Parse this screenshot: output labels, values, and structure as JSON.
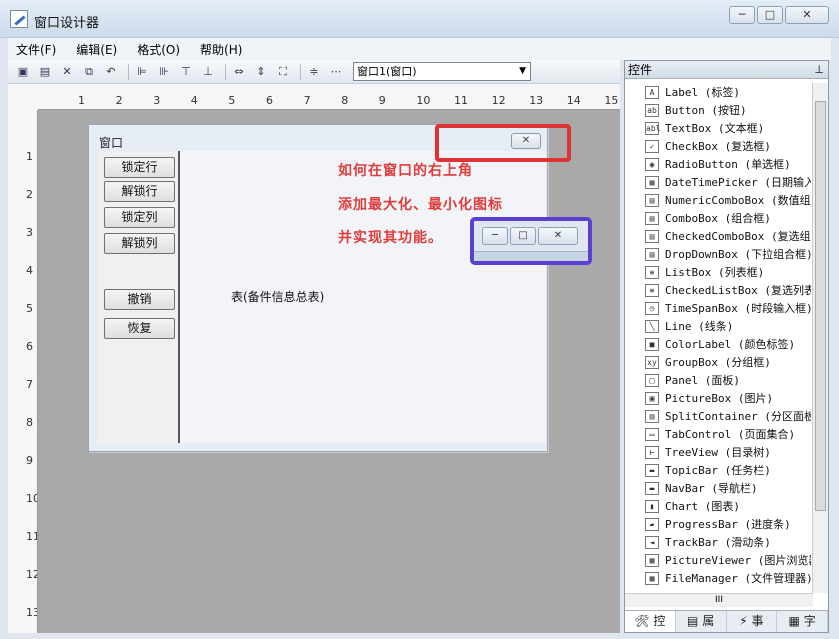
{
  "window": {
    "title": "窗口设计器",
    "min": "─",
    "max": "□",
    "close": "✕"
  },
  "menu": [
    "文件(F)",
    "编辑(E)",
    "格式(O)",
    "帮助(H)"
  ],
  "toolbar": {
    "combo_value": "窗口1(窗口)"
  },
  "ruler": {
    "h": [
      "1",
      "2",
      "3",
      "4",
      "5",
      "6",
      "7",
      "8",
      "9",
      "10",
      "11",
      "12",
      "13",
      "14",
      "15"
    ],
    "v": [
      "1",
      "2",
      "3",
      "4",
      "5",
      "6",
      "7",
      "8",
      "9",
      "10",
      "11",
      "12",
      "13"
    ]
  },
  "form": {
    "title": "窗口",
    "close": "✕",
    "buttons": [
      "锁定行",
      "解锁行",
      "锁定列",
      "解锁列",
      "撤销",
      "恢复"
    ],
    "table_label": "表(备件信息总表)"
  },
  "annotation": {
    "lines": [
      "如何在窗口的右上角",
      "添加最大化、最小化图标",
      "并实现其功能。"
    ],
    "btn_min": "─",
    "btn_max": "□",
    "btn_close": "✕"
  },
  "panel": {
    "title": "控件",
    "items": [
      {
        "icon": "A",
        "name": "Label (标签)"
      },
      {
        "icon": "ab",
        "name": "Button (按钮)"
      },
      {
        "icon": "abl",
        "name": "TextBox (文本框)"
      },
      {
        "icon": "✓",
        "name": "CheckBox (复选框)"
      },
      {
        "icon": "◉",
        "name": "RadioButton (单选框)"
      },
      {
        "icon": "▦",
        "name": "DateTimePicker (日期输入框)"
      },
      {
        "icon": "▤",
        "name": "NumericComboBox (数值组合框)"
      },
      {
        "icon": "▤",
        "name": "ComboBox (组合框)"
      },
      {
        "icon": "▤",
        "name": "CheckedComboBox (复选组合框)"
      },
      {
        "icon": "▤",
        "name": "DropDownBox (下拉组合框)"
      },
      {
        "icon": "≡",
        "name": "ListBox (列表框)"
      },
      {
        "icon": "≡",
        "name": "CheckedListBox (复选列表框)"
      },
      {
        "icon": "◷",
        "name": "TimeSpanBox (时段输入框)"
      },
      {
        "icon": "╲",
        "name": "Line (线条)"
      },
      {
        "icon": "■",
        "name": "ColorLabel (颜色标签)"
      },
      {
        "icon": "xy",
        "name": "GroupBox (分组框)"
      },
      {
        "icon": "□",
        "name": "Panel (面板)"
      },
      {
        "icon": "▣",
        "name": "PictureBox (图片)"
      },
      {
        "icon": "▥",
        "name": "SplitContainer (分区面板)"
      },
      {
        "icon": "▭",
        "name": "TabControl (页面集合)"
      },
      {
        "icon": "⊢",
        "name": "TreeView (目录树)"
      },
      {
        "icon": "▬",
        "name": "TopicBar (任务栏)"
      },
      {
        "icon": "▬",
        "name": "NavBar (导航栏)"
      },
      {
        "icon": "▮",
        "name": "Chart (图表)"
      },
      {
        "icon": "▰",
        "name": "ProgressBar (进度条)"
      },
      {
        "icon": "◄",
        "name": "TrackBar (滑动条)"
      },
      {
        "icon": "▩",
        "name": "PictureViewer (图片浏览器)"
      },
      {
        "icon": "▩",
        "name": "FileManager (文件管理器)"
      }
    ],
    "hscroll": "III",
    "tabs": [
      "控",
      "属",
      "事",
      "字"
    ]
  },
  "colors": {
    "annotation": "#e03c3c",
    "red_box": "#dd3333",
    "blue_box": "#5a3fd0"
  }
}
